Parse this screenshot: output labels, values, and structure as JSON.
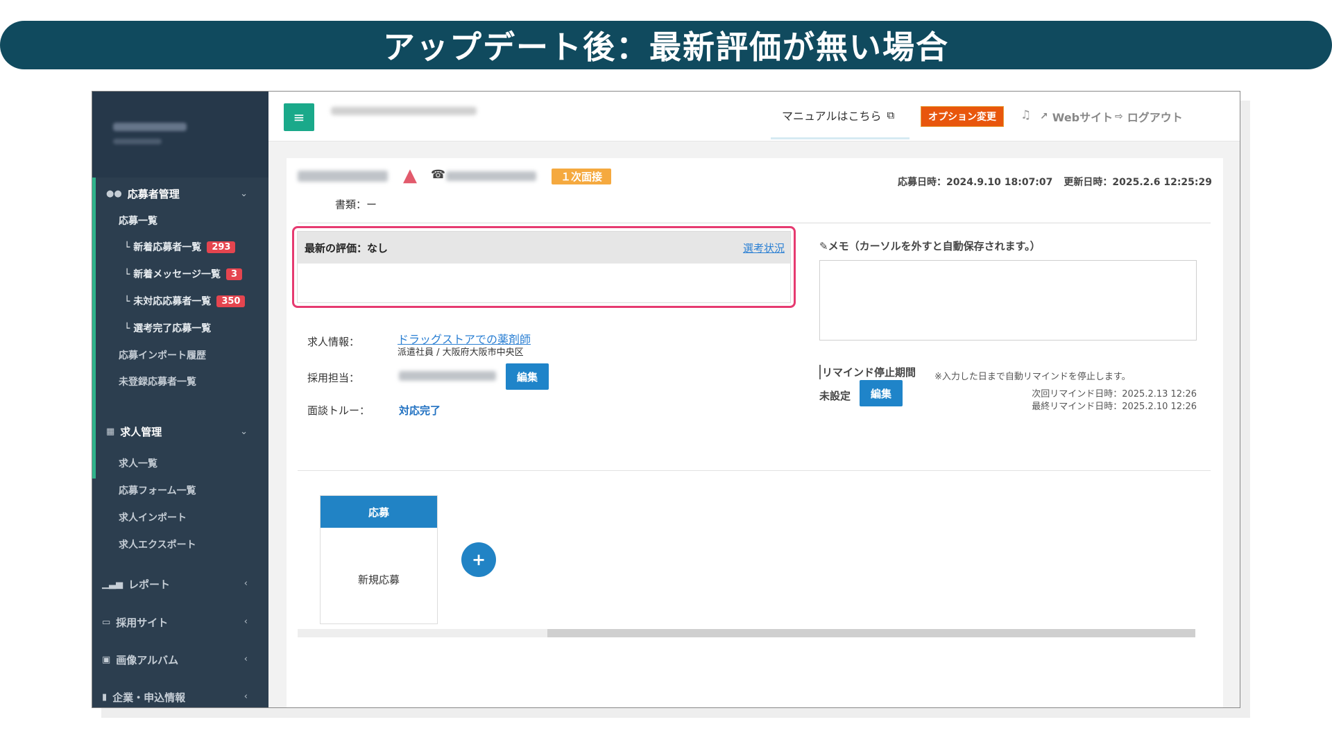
{
  "banner": {
    "title": "アップデート後：最新評価が無い場合"
  },
  "sidebar": {
    "applicant_mgmt": {
      "title": "応募者管理",
      "items": [
        {
          "label": "応募一覧",
          "badge": ""
        },
        {
          "label": "└ 新着応募者一覧",
          "badge": "293"
        },
        {
          "label": "└ 新着メッセージ一覧",
          "badge": "3"
        },
        {
          "label": "└ 未対応応募者一覧",
          "badge": "350"
        },
        {
          "label": "└ 選考完了応募一覧",
          "badge": ""
        },
        {
          "label": "応募インポート履歴",
          "badge": ""
        },
        {
          "label": "未登録応募者一覧",
          "badge": ""
        }
      ]
    },
    "job_mgmt": {
      "title": "求人管理",
      "items": [
        {
          "label": "求人一覧"
        },
        {
          "label": "応募フォーム一覧"
        },
        {
          "label": "求人インポート"
        },
        {
          "label": "求人エクスポート"
        }
      ]
    },
    "collapsed": [
      {
        "label": "レポート"
      },
      {
        "label": "採用サイト"
      },
      {
        "label": "画像アルバム"
      },
      {
        "label": "企業・申込情報"
      }
    ]
  },
  "topbar": {
    "manual": "マニュアルはこちら",
    "option_change": "オプション変更",
    "website": "Webサイト",
    "logout": "ログアウト"
  },
  "applicant": {
    "stage": "１次面接",
    "applied_at": "応募日時：2024.9.10 18:07:07",
    "updated_at": "更新日時：2025.2.6 12:25:29",
    "documents": "書類：ー"
  },
  "evaluation": {
    "title": "最新の評価：なし",
    "link": "選考状況"
  },
  "memo": {
    "label": "メモ（カーソルを外すと自動保存されます。）"
  },
  "job_info": {
    "label": "求人情報：",
    "title": "ドラッグストアでの薬剤師",
    "sub": "派遣社員 / 大阪府大阪市中央区"
  },
  "recruiter": {
    "label": "採用担当：",
    "edit": "編集"
  },
  "interview": {
    "label": "面談トルー：",
    "status": "対応完了"
  },
  "remind": {
    "label": "リマインド停止期間",
    "note": "※入力した日まで自動リマインドを停止します。",
    "status": "未設定",
    "edit": "編集",
    "next": "次回リマインド日時：2025.2.13 12:26",
    "last": "最終リマインド日時：2025.2.10 12:26"
  },
  "kanban": {
    "column": "応募",
    "item": "新規応募",
    "add": "+"
  }
}
